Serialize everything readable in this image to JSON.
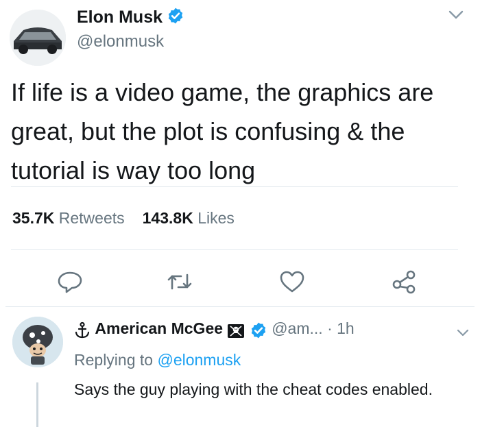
{
  "tweet": {
    "author_name": "Elon Musk",
    "author_handle": "@elonmusk",
    "text": "If life is a video game, the graphics are great, but the plot is confusing & the tutorial is way too long",
    "retweets_count": "35.7K",
    "retweets_label": "Retweets",
    "likes_count": "143.8K",
    "likes_label": "Likes"
  },
  "reply": {
    "author_name": "American McGee",
    "author_handle": "@am...",
    "separator": "·",
    "time": "1h",
    "replying_prefix": "Replying to",
    "replying_to": "@elonmusk",
    "text": "Says the guy playing with the cheat codes enabled."
  },
  "icons": {
    "verified": "verified-badge-icon",
    "reply": "reply-icon",
    "retweet": "retweet-icon",
    "like": "heart-icon",
    "share": "share-icon",
    "menu": "chevron-down-icon",
    "anchor": "anchor-icon",
    "pirate": "pirate-flag-icon"
  },
  "colors": {
    "verified_blue": "#1da1f2",
    "secondary_text": "#66757f",
    "primary_text": "#14171a",
    "divider": "#e1e8ed"
  }
}
